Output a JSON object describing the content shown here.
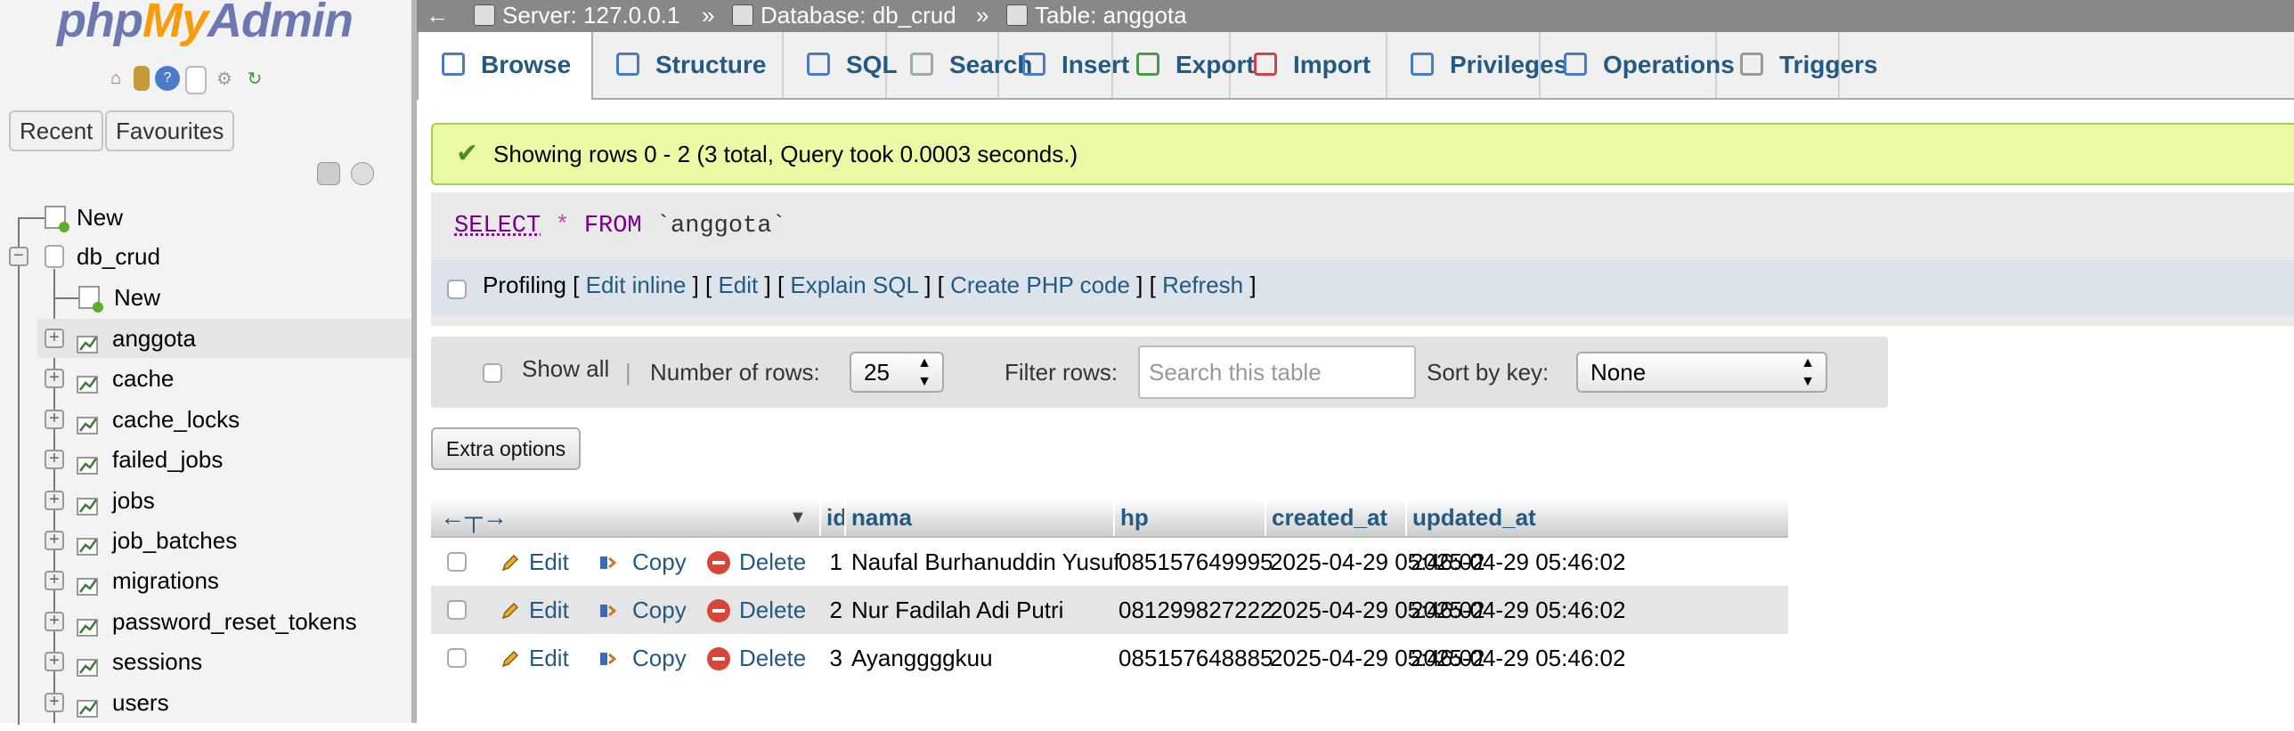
{
  "sidebar": {
    "logo": {
      "php": "php",
      "my": "My",
      "admin": "Admin"
    },
    "nav_icons": [
      "home-icon",
      "database-icon",
      "help-icon",
      "docs-icon",
      "settings-icon",
      "reload-icon"
    ],
    "recent_label": "Recent",
    "favourites_label": "Favourites",
    "tree": {
      "root_new": "New",
      "database": "db_crud",
      "db_new": "New",
      "tables": [
        "anggota",
        "cache",
        "cache_locks",
        "failed_jobs",
        "jobs",
        "job_batches",
        "migrations",
        "password_reset_tokens",
        "sessions",
        "users"
      ],
      "selected_table": "anggota"
    }
  },
  "breadcrumb": {
    "server": "Server: 127.0.0.1",
    "database": "Database: db_crud",
    "table": "Table: anggota",
    "separator": "»"
  },
  "tabs": [
    "Browse",
    "Structure",
    "SQL",
    "Search",
    "Insert",
    "Export",
    "Import",
    "Privileges",
    "Operations",
    "Triggers"
  ],
  "active_tab": "Browse",
  "message": "Showing rows 0 - 2 (3 total, Query took 0.0003 seconds.)",
  "query": {
    "select": "SELECT",
    "star": "*",
    "from": "FROM",
    "table": "`anggota`"
  },
  "profiling": {
    "label": "Profiling",
    "links": [
      "Edit inline",
      "Edit",
      "Explain SQL",
      "Create PHP code",
      "Refresh"
    ]
  },
  "navigation": {
    "show_all_label": "Show all",
    "rows_label": "Number of rows:",
    "rows_value": "25",
    "filter_label": "Filter rows:",
    "filter_placeholder": "Search this table",
    "sort_label": "Sort by key:",
    "sort_value": "None"
  },
  "extra_options_label": "Extra options",
  "table": {
    "columns": [
      "id",
      "nama",
      "hp",
      "created_at",
      "updated_at"
    ],
    "actions": {
      "edit": "Edit",
      "copy": "Copy",
      "delete": "Delete"
    },
    "rows": [
      {
        "id": "1",
        "nama": "Naufal Burhanuddin Yusuf",
        "hp": "085157649995",
        "created_at": "2025-04-29 05:46:02",
        "updated_at": "2025-04-29 05:46:02"
      },
      {
        "id": "2",
        "nama": "Nur Fadilah Adi Putri",
        "hp": "081299827222",
        "created_at": "2025-04-29 05:46:02",
        "updated_at": "2025-04-29 05:46:02"
      },
      {
        "id": "3",
        "nama": "Ayanggggkuu",
        "hp": "085157648885",
        "created_at": "2025-04-29 05:46:02",
        "updated_at": "2025-04-29 05:46:02"
      }
    ]
  },
  "colors": {
    "link": "#235a81",
    "success_bg": "#ebf8a4",
    "sidebar_bg": "#f3f3f3",
    "topbar_bg": "#888888"
  }
}
